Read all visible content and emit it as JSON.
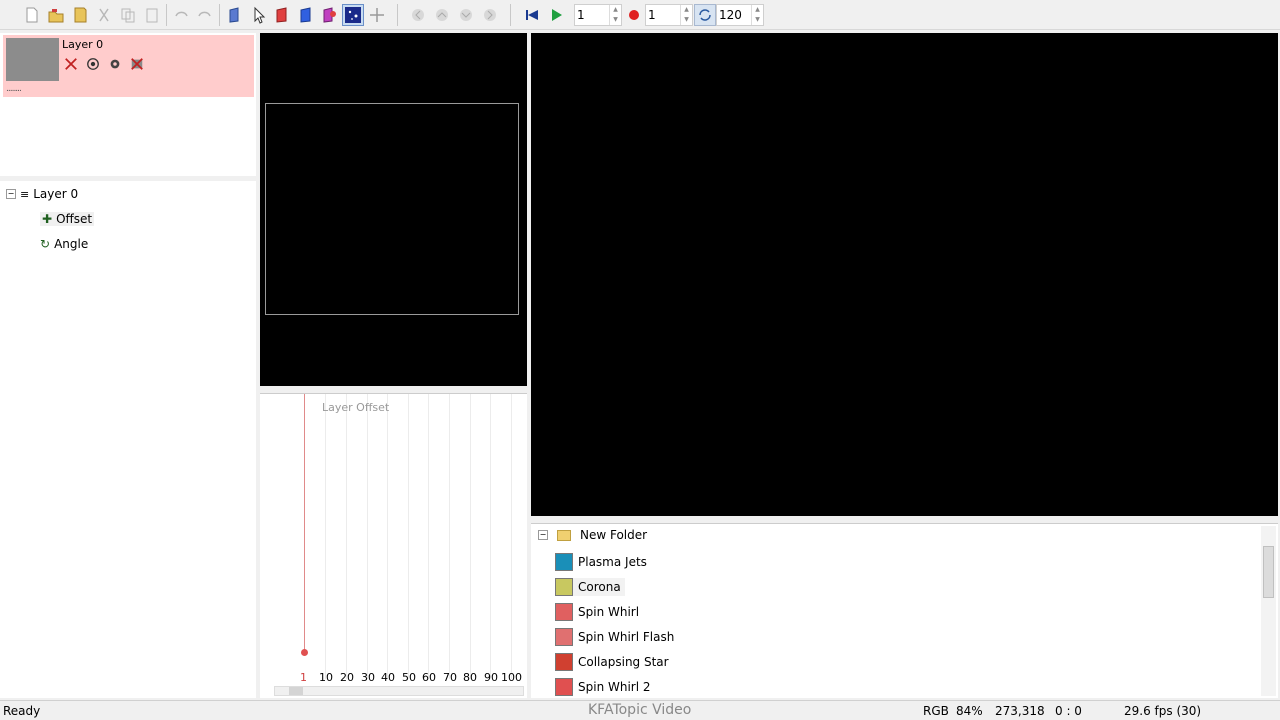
{
  "toolbar": {
    "start_frame": "1",
    "record_value": "1",
    "end_frame": "120",
    "icons": [
      "new-icon",
      "open-icon",
      "save-icon",
      "cut-icon",
      "copy-icon",
      "paste-icon",
      "undo-icon",
      "redo-icon",
      "select-icon",
      "pointer-icon",
      "red-tool-icon",
      "blue-tool-icon",
      "effect-icon",
      "starfield-icon",
      "transform-icon",
      "nav-left-icon",
      "nav-up-icon",
      "nav-down-icon",
      "nav-right-icon",
      "rewind-icon",
      "play-icon",
      "record-icon",
      "loop-icon"
    ]
  },
  "layers": {
    "name": "Layer 0",
    "dots": "........"
  },
  "tree": {
    "root": "Layer 0",
    "children": [
      "Offset",
      "Angle"
    ]
  },
  "timeline": {
    "label": "Layer Offset",
    "ticks": [
      "1",
      "10",
      "20",
      "30",
      "40",
      "50",
      "60",
      "70",
      "80",
      "90",
      "100"
    ]
  },
  "library": {
    "folder": "New Folder",
    "items": [
      {
        "label": "Plasma Jets",
        "color": "#1a8fb8"
      },
      {
        "label": "Corona",
        "color": "#c8c860"
      },
      {
        "label": "Spin Whirl",
        "color": "#e06060"
      },
      {
        "label": "Spin Whirl Flash",
        "color": "#e07070"
      },
      {
        "label": "Collapsing Star",
        "color": "#d04030"
      },
      {
        "label": "Spin Whirl 2",
        "color": "#e05050"
      }
    ]
  },
  "status": {
    "ready": "Ready",
    "watermark": "KFATopic Video",
    "mode": "RGB",
    "zoom": "84%",
    "coords": "273,318",
    "time": "0 : 0",
    "fps": "29.6 fps (30)"
  }
}
